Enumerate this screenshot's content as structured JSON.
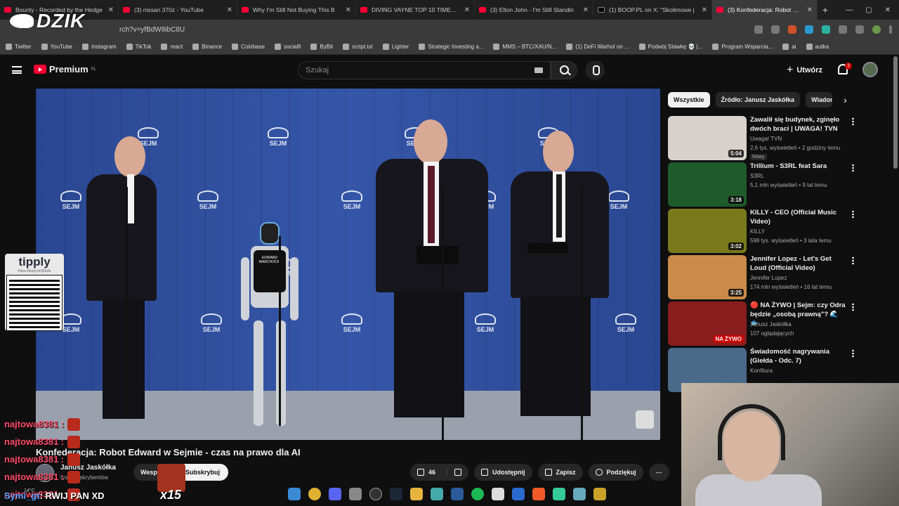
{
  "browser": {
    "tabs": [
      {
        "title": "Bounty - Recorded by the Hedge",
        "icon": "youtube-icon"
      },
      {
        "title": "(3) nissan 370z - YouTube",
        "icon": "youtube-icon"
      },
      {
        "title": "Why I'm Still Not Buying This B",
        "icon": "youtube-icon"
      },
      {
        "title": "DIVING VAYNE TOP 10 TIMES T",
        "icon": "youtube-icon"
      },
      {
        "title": "(3) Elton John - I'm Still Standin",
        "icon": "youtube-icon"
      },
      {
        "title": "(1) BOOP.PL on X: \"Skolimowe j",
        "icon": "x-icon"
      },
      {
        "title": "(3) Konfederacja: Robot Edward",
        "icon": "youtube-icon",
        "active": true
      }
    ],
    "url": "rch?v=yfBdW8ibC8U",
    "bookmarks": [
      "Twitter",
      "YouTube",
      "Instagram",
      "TikTok",
      "react",
      "Binance",
      "Coinbase",
      "socialfi",
      "ByBit",
      "script.txt",
      "Lighter",
      "Strategic Investing a...",
      "MMS – BTC/XAU/N...",
      "(1) DeFi Warhol on ...",
      "Podwój Stawkę 💀 |...",
      "Program Wsparcia...",
      "ai",
      "autka"
    ]
  },
  "overlay": {
    "logo": "DZIK",
    "tipply_title": "tipply",
    "tipply_url": "https://tipply.pl/@dzik",
    "chat": [
      {
        "user": "najtowa8381 :"
      },
      {
        "user": "najtowa8381 :"
      },
      {
        "user": "najtowa8381 :"
      },
      {
        "user": "najtowa8381 :"
      },
      {
        "user": "najtowa8381 :"
      }
    ],
    "bottom_user": "Symi_gt",
    "bottom_text": ": RWIJ PAN XD",
    "multiplier": "x15",
    "weather": "14°C"
  },
  "youtube": {
    "logo_text": "Premium",
    "logo_region": "PL",
    "search_placeholder": "Szukaj",
    "create_label": "Utwórz",
    "notif_count": "3",
    "video": {
      "title": "Konfederacja: Robot Edward w Sejmie - czas na prawo dla AI",
      "channel": "Janusz Jaskółka",
      "subs": "tys. subskrybentów",
      "support_label": "Wesprzyj",
      "subscribe_label": "Subskrybuj",
      "likes": "46",
      "share_label": "Udostępnij",
      "save_label": "Zapisz",
      "thanks_label": "Podziękuj",
      "sejm_label": "SEJM",
      "robot_vest": "EDWARD WARCHOCKI"
    },
    "chips": [
      "Wszystkie",
      "Źródło: Janusz Jaskółka",
      "Wiadomo"
    ],
    "recommendations": [
      {
        "title": "Zawalił się budynek, zginęło dwóch braci | UWAGA! TVN",
        "channel": "Uwaga! TVN",
        "meta": "2,6 tys. wyświetleń • 2 godziny temu",
        "badge": "Nowy",
        "duration": "5:04",
        "color": "#d9d2cc"
      },
      {
        "title": "Trillium - S3RL feat Sara",
        "channel": "S3RL",
        "meta": "5,1 mln wyświetleń • 9 lat temu",
        "duration": "3:18",
        "color": "#1f5a2a"
      },
      {
        "title": "KILLY - CEO (Official Music Video)",
        "channel": "KILLY",
        "meta": "598 tys. wyświetleń • 3 lata temu",
        "duration": "3:02",
        "color": "#7a7a1c"
      },
      {
        "title": "Jennifer Lopez - Let's Get Loud (Official Video)",
        "channel": "Jennifer Lopez",
        "meta": "174 mln wyświetleń • 16 lat temu",
        "duration": "3:25",
        "color": "#c98a4a"
      },
      {
        "title": "🔴 NA ŻYWO | Sejm: czy Odra będzie „osobą prawną\"? 🌊 🐟",
        "channel": "Janusz Jaskółka",
        "meta": "107 oglądających",
        "live": "NA ŻYWO",
        "color": "#8a1d1d"
      },
      {
        "title": "Świadomość nagrywania (Giełda - Odc. 7)",
        "channel": "Konfitura",
        "meta": "",
        "color": "#4a6a8a"
      }
    ]
  }
}
